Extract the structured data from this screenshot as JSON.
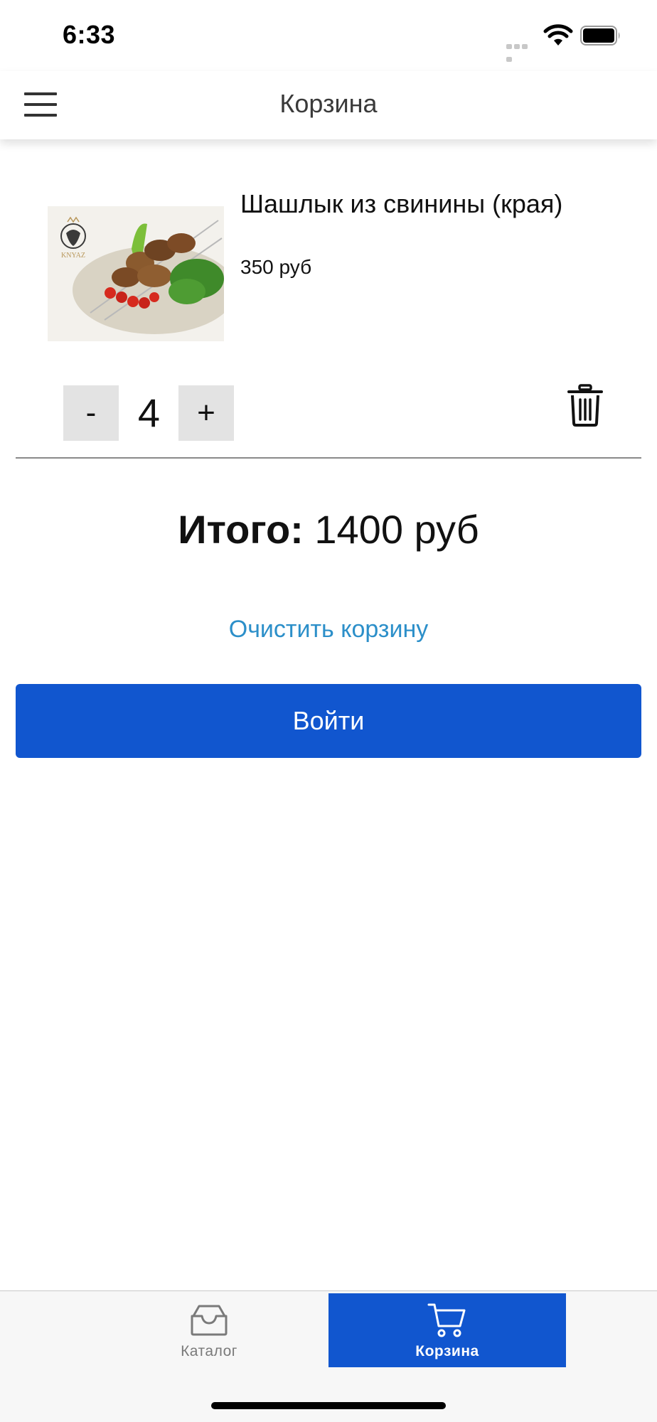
{
  "status_bar": {
    "time": "6:33"
  },
  "header": {
    "title": "Корзина",
    "menu_icon": "hamburger-menu-icon"
  },
  "cart": {
    "items": [
      {
        "name": "Шашлык из свинины (края)",
        "price": "350 руб",
        "quantity": "4",
        "image_logo_text": "KNYAZ",
        "minus_label": "-",
        "plus_label": "+",
        "delete_icon": "trash-icon"
      }
    ],
    "total_label": "Итого:",
    "total_value": "1400 руб",
    "clear_label": "Очистить корзину",
    "login_label": "Войти"
  },
  "tab_bar": {
    "tabs": [
      {
        "label": "Каталог",
        "icon": "inbox-tray-icon",
        "active": false
      },
      {
        "label": "Корзина",
        "icon": "shopping-cart-icon",
        "active": true
      }
    ]
  },
  "colors": {
    "accent": "#1156cf",
    "link": "#2c8fc9",
    "stepper_bg": "#e3e3e3",
    "tab_bar_bg": "#f7f7f7"
  }
}
